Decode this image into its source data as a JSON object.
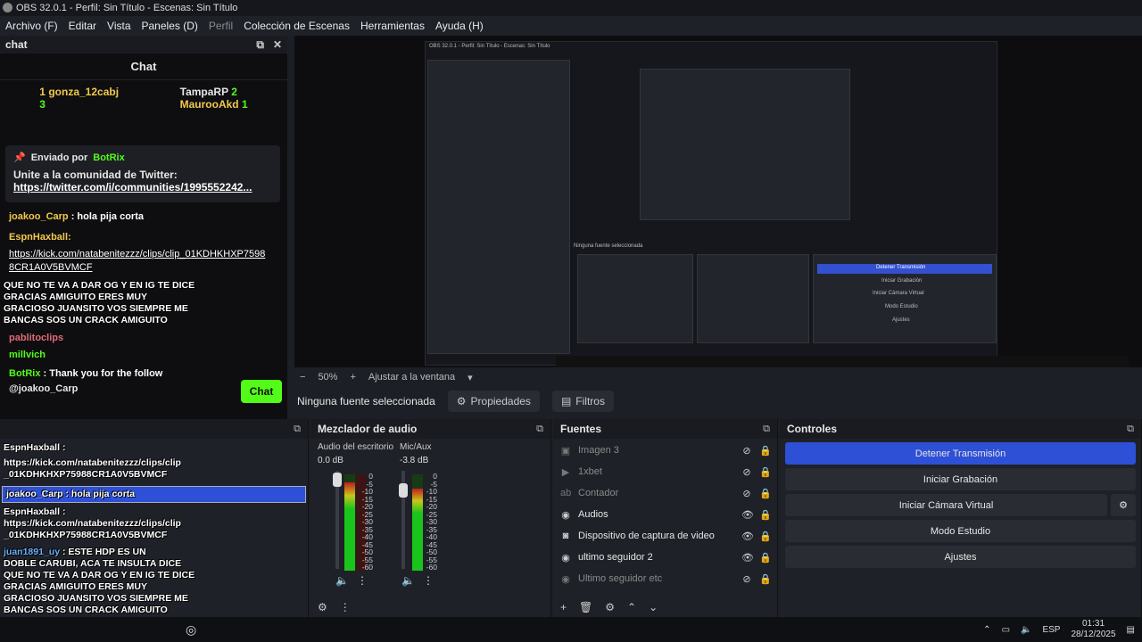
{
  "window": {
    "title": "OBS 32.0.1 - Perfil: Sin Título - Escenas: Sin Título"
  },
  "menu": [
    {
      "label": "Archivo (F)",
      "dim": false
    },
    {
      "label": "Editar",
      "dim": false
    },
    {
      "label": "Vista",
      "dim": false
    },
    {
      "label": "Paneles (D)",
      "dim": false
    },
    {
      "label": "Perfil",
      "dim": true
    },
    {
      "label": "Colección de Escenas",
      "dim": false
    },
    {
      "label": "Herramientas",
      "dim": false
    },
    {
      "label": "Ayuda (H)",
      "dim": false
    }
  ],
  "chat_dock": {
    "dock_title": "chat",
    "title": "Chat",
    "leaders": [
      {
        "rank": "1",
        "name": "gonza_12cabj",
        "count": "3"
      },
      {
        "rank": "",
        "name": "TampaRP",
        "count": "2"
      },
      {
        "rank": "",
        "name": "MaurooAkd",
        "count": "1"
      }
    ],
    "pinned": {
      "by_label": "Enviado por",
      "by_user": "BotRix",
      "text": "Unite a la comunidad de Twitter:",
      "link": "https://twitter.com/i/communities/1995552242..."
    },
    "messages": [
      {
        "user": "joakoo_Carp",
        "text": ": hola pija corta"
      },
      {
        "user": "EspnHaxball:",
        "text": ""
      },
      {
        "user": "",
        "text": "https://kick.com/natabenitezzz/clips/clip_01KDHKHXP7598 8CR1A0V5BVMCF"
      }
    ],
    "overlay_lines": [
      "QUE NO TE VA A DAR OG Y EN IG TE DICE",
      "GRACIAS AMIGUITO ERES MUY",
      "GRACIOSO JUANSITO VOS SIEMPRE ME",
      "BANCAS SOS UN CRACK AMIGUITO"
    ],
    "overlay_user1": "pablitoclips",
    "overlay_user2": "millvich",
    "bot_message": {
      "user": "BotRix",
      "text": ": Thank you for the follow"
    },
    "mention": "@joakoo_Carp",
    "send_button": "Chat"
  },
  "preview": {
    "nested_title": "OBS 32.0.1 - Perfil: Sin Título - Escenas: Sin Título",
    "nested_no_source": "Ninguna fuente seleccionada",
    "nested_controls": [
      "Detener Transmisión",
      "Iniciar Grabación",
      "Iniciar Cámara Virtual",
      "Modo Estudio",
      "Ajustes"
    ]
  },
  "zoom": {
    "percent": "50%",
    "fit": "Ajustar a la ventana"
  },
  "source_toolbar": {
    "no_source": "Ninguna fuente seleccionada",
    "properties": "Propiedades",
    "filters": "Filtros"
  },
  "scenes_dock": {
    "lines": [
      "EspnHaxball :",
      "https://kick.com/natabenitezzz/clips/clip",
      "_01KDHKHXP75988CR1A0V5BVMCF",
      "joakoo_Carp : hola pija corta",
      "EspnHaxball :",
      "https://kick.com/natabenitezzz/clips/clip",
      "_01KDHKHXP75988CR1A0V5BVMCF"
    ],
    "juan_user": "juan1891_uy",
    "juan_lines": [
      ": ESTE HDP ES UN",
      "DOBLE CARUBI, ACA TE INSULTA DICE",
      "QUE NO TE VA A DAR OG Y EN IG TE DICE",
      "GRACIAS AMIGUITO ERES MUY",
      "GRACIOSO JUANSITO VOS SIEMPRE ME",
      "BANCAS SOS UN CRACK AMIGUITO"
    ]
  },
  "mixer": {
    "title": "Mezclador de audio",
    "channels": [
      {
        "name": "Audio del escritorio",
        "db": "0.0 dB",
        "level": 0.92
      },
      {
        "name": "Mic/Aux",
        "db": "-3.8 dB",
        "level": 0.85
      }
    ],
    "scale": [
      "0",
      "-5",
      "-10",
      "-15",
      "-20",
      "-25",
      "-30",
      "-35",
      "-40",
      "-45",
      "-50",
      "-55",
      "-60"
    ]
  },
  "sources": {
    "title": "Fuentes",
    "items": [
      {
        "name": "Imagen 3",
        "icon": "image-icon",
        "glyph": "▣",
        "visible": false
      },
      {
        "name": "1xbet",
        "icon": "media-icon",
        "glyph": "▶",
        "visible": false
      },
      {
        "name": "Contador",
        "icon": "text-icon",
        "glyph": "ab",
        "visible": false
      },
      {
        "name": "Audios",
        "icon": "browser-icon",
        "glyph": "◉",
        "visible": true
      },
      {
        "name": "Dispositivo de captura de video",
        "icon": "camera-icon",
        "glyph": "◙",
        "visible": true
      },
      {
        "name": "ultimo seguidor 2",
        "icon": "browser-icon",
        "glyph": "◉",
        "visible": true
      },
      {
        "name": "Ultimo seguidor etc",
        "icon": "browser-icon",
        "glyph": "◉",
        "visible": false
      }
    ]
  },
  "controls": {
    "title": "Controles",
    "buttons": [
      {
        "label": "Detener Transmisión",
        "primary": true
      },
      {
        "label": "Iniciar Grabación",
        "primary": false
      },
      {
        "label": "Iniciar Cámara Virtual",
        "primary": false
      },
      {
        "label": "Modo Estudio",
        "primary": false
      },
      {
        "label": "Ajustes",
        "primary": false
      }
    ]
  },
  "taskbar": {
    "lang": "ESP",
    "time": "01:31",
    "date": "28/12/2025"
  },
  "colors": {
    "kick_green": "#53fc18",
    "obs_blue": "#2d50d6",
    "gold": "#f2c94c"
  }
}
